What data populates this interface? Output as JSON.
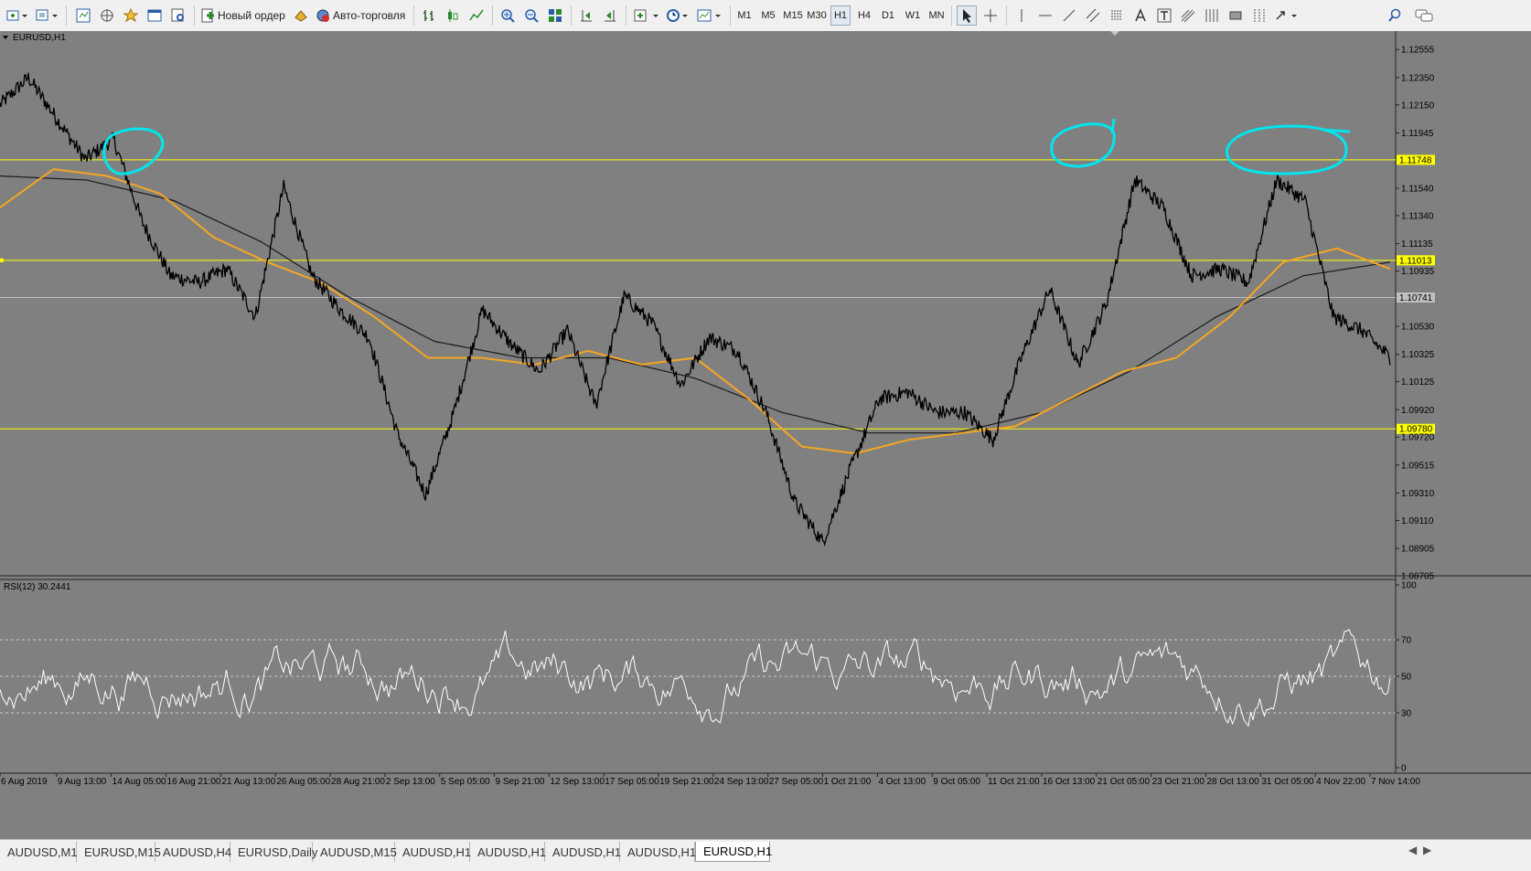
{
  "toolbar": {
    "new_order_label": "Новый ордер",
    "autotrade_label": "Авто-торговля",
    "timeframes": [
      "M1",
      "M5",
      "M15",
      "M30",
      "H1",
      "H4",
      "D1",
      "W1",
      "MN"
    ],
    "active_timeframe": "H1",
    "icons": [
      "new-chart-icon",
      "profiles-icon",
      "market-watch-icon",
      "navigator-icon",
      "favorites-icon",
      "data-window-icon",
      "tester-icon",
      "metaeditor-icon",
      "bar-chart-icon",
      "candles-icon",
      "line-chart-icon",
      "zoom-in-icon",
      "zoom-out-icon",
      "tile-windows-icon",
      "autoscroll-icon",
      "chart-shift-icon",
      "indicators-icon",
      "periods-icon",
      "templates-icon",
      "cursor-icon",
      "crosshair-icon",
      "vertical-line-icon",
      "horizontal-line-icon",
      "trendline-icon",
      "equidistant-channel-icon",
      "fibonacci-icon",
      "text-icon",
      "text-label-icon",
      "andrews-pitchfork-icon",
      "gann-icon",
      "rectangle-icon",
      "cycle-lines-icon",
      "arrows-icon",
      "search-icon",
      "chat-icon"
    ]
  },
  "chart": {
    "symbol_label": "EURUSD,H1",
    "indicator_label": "RSI(12) 30.2441",
    "colors": {
      "background": "#808080",
      "price_line": "#000000",
      "ma_fast": "#f5a623",
      "ma_slow": "#1a1a1a",
      "level_lines": "#ffff00",
      "gray_line": "#c0c0c0",
      "annotations": "#00e5ee",
      "rsi_line": "#ffffff"
    },
    "price_axis_ticks": [
      "1.12555",
      "1.12350",
      "1.12150",
      "1.11945",
      "1.11540",
      "1.11340",
      "1.11135",
      "1.10935",
      "1.10530",
      "1.10325",
      "1.10125",
      "1.09920",
      "1.09720",
      "1.09515",
      "1.09310",
      "1.09110",
      "1.08905",
      "1.08705"
    ],
    "level_tags": [
      {
        "price": 1.11748,
        "label": "1.11748",
        "color": "#ffff00"
      },
      {
        "price": 1.11013,
        "label": "1.11013",
        "color": "#ffff00"
      },
      {
        "price": 1.10741,
        "label": "1.10741",
        "color": "#c0c0c0"
      },
      {
        "price": 1.0978,
        "label": "1.09780",
        "color": "#ffff00"
      }
    ],
    "rsi_axis_ticks": [
      "100",
      "70",
      "50",
      "30",
      "0"
    ],
    "time_axis_ticks": [
      "6 Aug 2019",
      "9 Aug 13:00",
      "14 Aug 05:00",
      "16 Aug 21:00",
      "21 Aug 13:00",
      "26 Aug 05:00",
      "28 Aug 21:00",
      "2 Sep 13:00",
      "5 Sep 05:00",
      "9 Sep 21:00",
      "12 Sep 13:00",
      "17 Sep 05:00",
      "19 Sep 21:00",
      "24 Sep 13:00",
      "27 Sep 05:00",
      "1 Oct 21:00",
      "4 Oct 13:00",
      "9 Oct 05:00",
      "11 Oct 21:00",
      "16 Oct 13:00",
      "21 Oct 05:00",
      "23 Oct 21:00",
      "28 Oct 13:00",
      "31 Oct 05:00",
      "4 Nov 22:00",
      "7 Nov 14:00"
    ]
  },
  "chart_data": {
    "type": "line",
    "title": "EURUSD,H1",
    "ylim": [
      1.08705,
      1.1265
    ],
    "levels": [
      1.11748,
      1.11013,
      1.10741,
      1.0978
    ],
    "series": [
      {
        "values": [
          1.1215,
          1.1235,
          1.1205,
          1.1175,
          1.119,
          1.113,
          1.109,
          1.1085,
          1.1095,
          1.106,
          1.1155,
          1.109,
          1.1065,
          1.1045,
          1.0975,
          1.093,
          1.099,
          1.1065,
          1.104,
          1.102,
          1.105,
          1.0995,
          1.1075,
          1.1055,
          1.101,
          1.1045,
          1.1035,
          1.099,
          1.0925,
          1.0895,
          1.095,
          1.1,
          1.1005,
          1.099,
          1.099,
          1.097,
          1.103,
          1.108,
          1.1025,
          1.107,
          1.116,
          1.114,
          1.109,
          1.1095,
          1.1085,
          1.116,
          1.1145,
          1.106,
          1.105,
          1.103
        ]
      },
      {
        "name": "MA (orange)",
        "values": [
          1.114,
          1.1168,
          1.1163,
          1.115,
          1.1118,
          1.11,
          1.1085,
          1.106,
          1.103,
          1.103,
          1.1025,
          1.1035,
          1.1025,
          1.103,
          1.1,
          1.0965,
          1.096,
          1.097,
          1.0975,
          1.098,
          1.1,
          1.102,
          1.103,
          1.106,
          1.11,
          1.111,
          1.1095
        ]
      },
      {
        "name": "MA (black)",
        "values": [
          1.1163,
          1.116,
          1.1145,
          1.1115,
          1.1075,
          1.1042,
          1.103,
          1.103,
          1.1015,
          1.099,
          1.0975,
          1.0975,
          1.099,
          1.102,
          1.106,
          1.109,
          1.11
        ]
      }
    ]
  },
  "tabs": [
    {
      "label": "AUDUSD,M1"
    },
    {
      "label": "EURUSD,M15"
    },
    {
      "label": "AUDUSD,H4"
    },
    {
      "label": "EURUSD,Daily"
    },
    {
      "label": "AUDUSD,M15"
    },
    {
      "label": "AUDUSD,H1"
    },
    {
      "label": "AUDUSD,H1"
    },
    {
      "label": "AUDUSD,H1"
    },
    {
      "label": "AUDUSD,H1"
    },
    {
      "label": "EURUSD,H1"
    }
  ],
  "active_tab_index": 9
}
